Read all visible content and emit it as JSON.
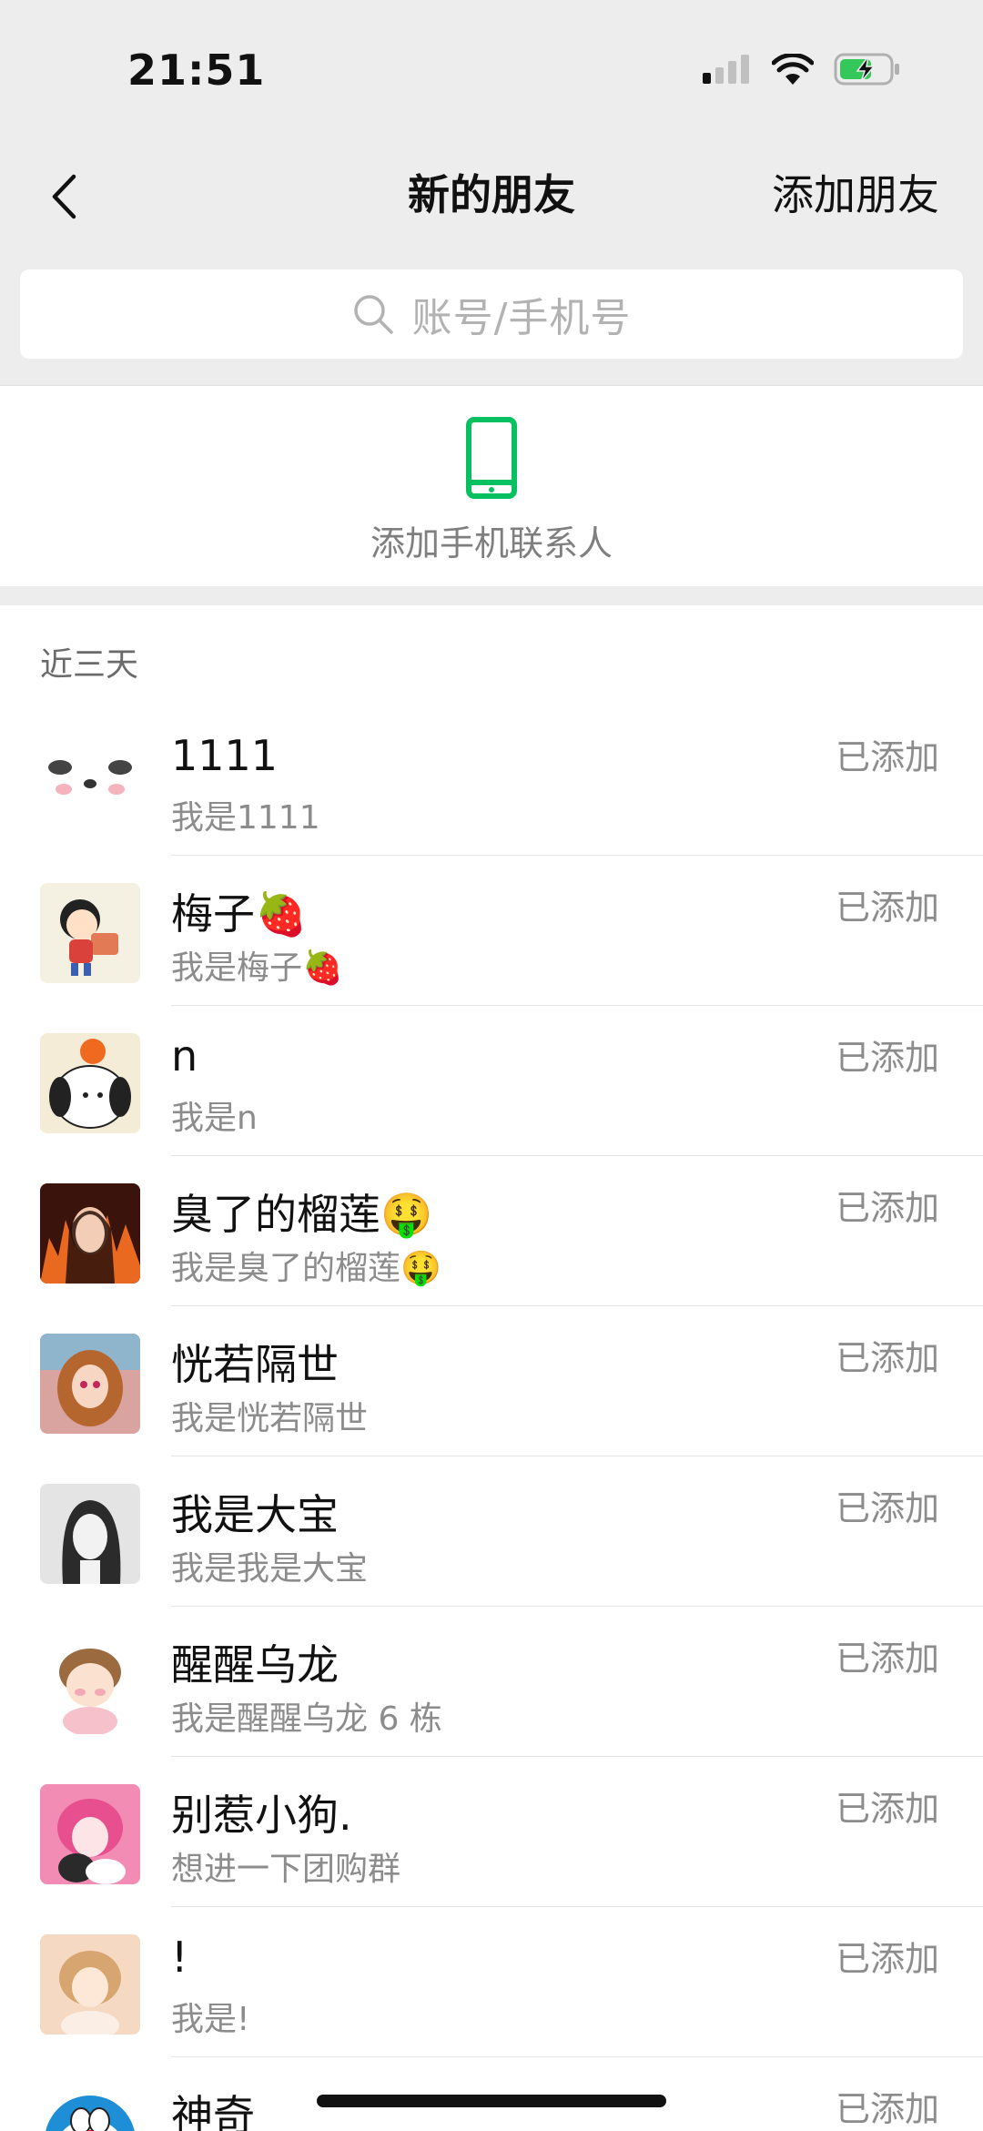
{
  "status_bar": {
    "time": "21:51"
  },
  "nav": {
    "title": "新的朋友",
    "right_action": "添加朋友"
  },
  "search": {
    "placeholder": "账号/手机号"
  },
  "phone_contacts": {
    "label": "添加手机联系人",
    "accent": "#07c160"
  },
  "section": {
    "header": "近三天"
  },
  "friends": [
    {
      "name": "1111",
      "message": "我是1111",
      "status": "已添加"
    },
    {
      "name": "梅子🍓",
      "message": "我是梅子🍓",
      "status": "已添加"
    },
    {
      "name": "n",
      "message": "我是n",
      "status": "已添加"
    },
    {
      "name": "臭了的榴莲🤑",
      "message": "我是臭了的榴莲🤑",
      "status": "已添加"
    },
    {
      "name": "恍若隔世",
      "message": "我是恍若隔世",
      "status": "已添加"
    },
    {
      "name": "我是大宝",
      "message": "我是我是大宝",
      "status": "已添加"
    },
    {
      "name": "醒醒乌龙",
      "message": "我是醒醒乌龙 6 栋",
      "status": "已添加"
    },
    {
      "name": "别惹小狗.",
      "message": "想进一下团购群",
      "status": "已添加"
    },
    {
      "name": "!",
      "message": "我是!",
      "status": "已添加"
    },
    {
      "name": "神奇",
      "message": "",
      "status": "已添加"
    }
  ]
}
